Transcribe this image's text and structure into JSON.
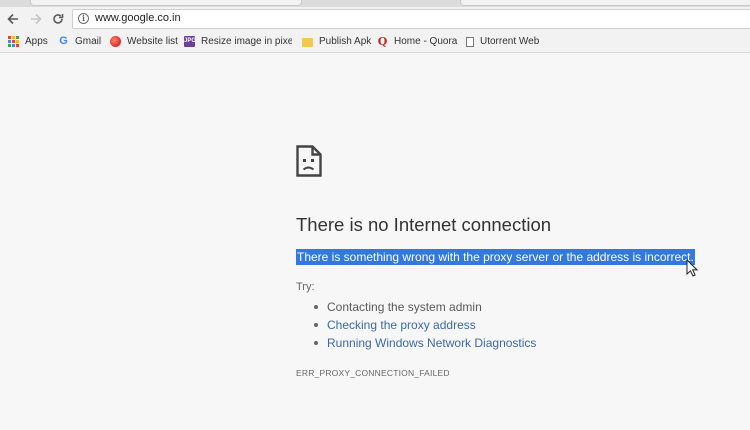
{
  "toolbar": {
    "url": "www.google.co.in",
    "back_icon": "arrow-left",
    "forward_icon": "arrow-right",
    "reload_icon": "reload",
    "info_icon": "info"
  },
  "bookmarks": [
    {
      "label": "Apps",
      "icon": "apps-grid"
    },
    {
      "label": "Gmail",
      "icon": "google-g"
    },
    {
      "label": "Website list",
      "icon": "website-list"
    },
    {
      "label": "Resize image in pixels",
      "icon": "jpg"
    },
    {
      "label": "Publish Apk",
      "icon": "folder"
    },
    {
      "label": "Home - Quora",
      "icon": "quora"
    },
    {
      "label": "Utorrent Web",
      "icon": "page"
    }
  ],
  "error": {
    "icon": "sad-page",
    "title": "There is no Internet connection",
    "description": "There is something wrong with the proxy server or the address is incorrect.",
    "try_label": "Try:",
    "suggestions": [
      "Contacting the system admin",
      "Checking the proxy address",
      "Running Windows Network Diagnostics"
    ],
    "code": "ERR_PROXY_CONNECTION_FAILED"
  },
  "colors": {
    "selection": "#3477e0",
    "link": "#3b69a8"
  }
}
